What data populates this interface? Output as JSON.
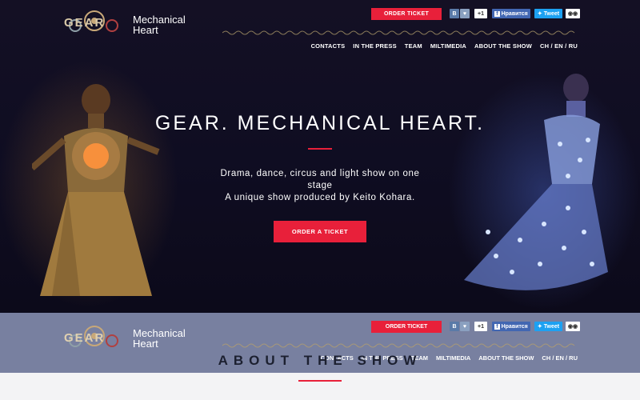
{
  "header": {
    "brand_line1": "Mechanical",
    "brand_line2": "Heart",
    "logo_text": "GEAR",
    "order_label": "ORDER TICKET",
    "social": {
      "vk": "B",
      "heart": "♥",
      "plus": "+1",
      "fb": "Нравится",
      "tweet": "Tweet"
    },
    "nav": [
      "CONTACTS",
      "IN THE PRESS",
      "TEAM",
      "MILTIMEDIA",
      "ABOUT THE SHOW",
      "CH / EN / RU"
    ]
  },
  "hero": {
    "title": "GEAR. MECHANICAL HEART.",
    "subtitle_line1": "Drama, dance, circus and light show on one",
    "subtitle_line2": "stage",
    "subtitle_line3": "A unique show produced by Keito Kohara.",
    "cta_label": "ORDER A TICKET"
  },
  "about": {
    "title": "ABOUT THE SHOW"
  },
  "colors": {
    "accent": "#e8203a",
    "sticky_bg": "#7880a0",
    "hero_bg": "#0f0d22"
  }
}
